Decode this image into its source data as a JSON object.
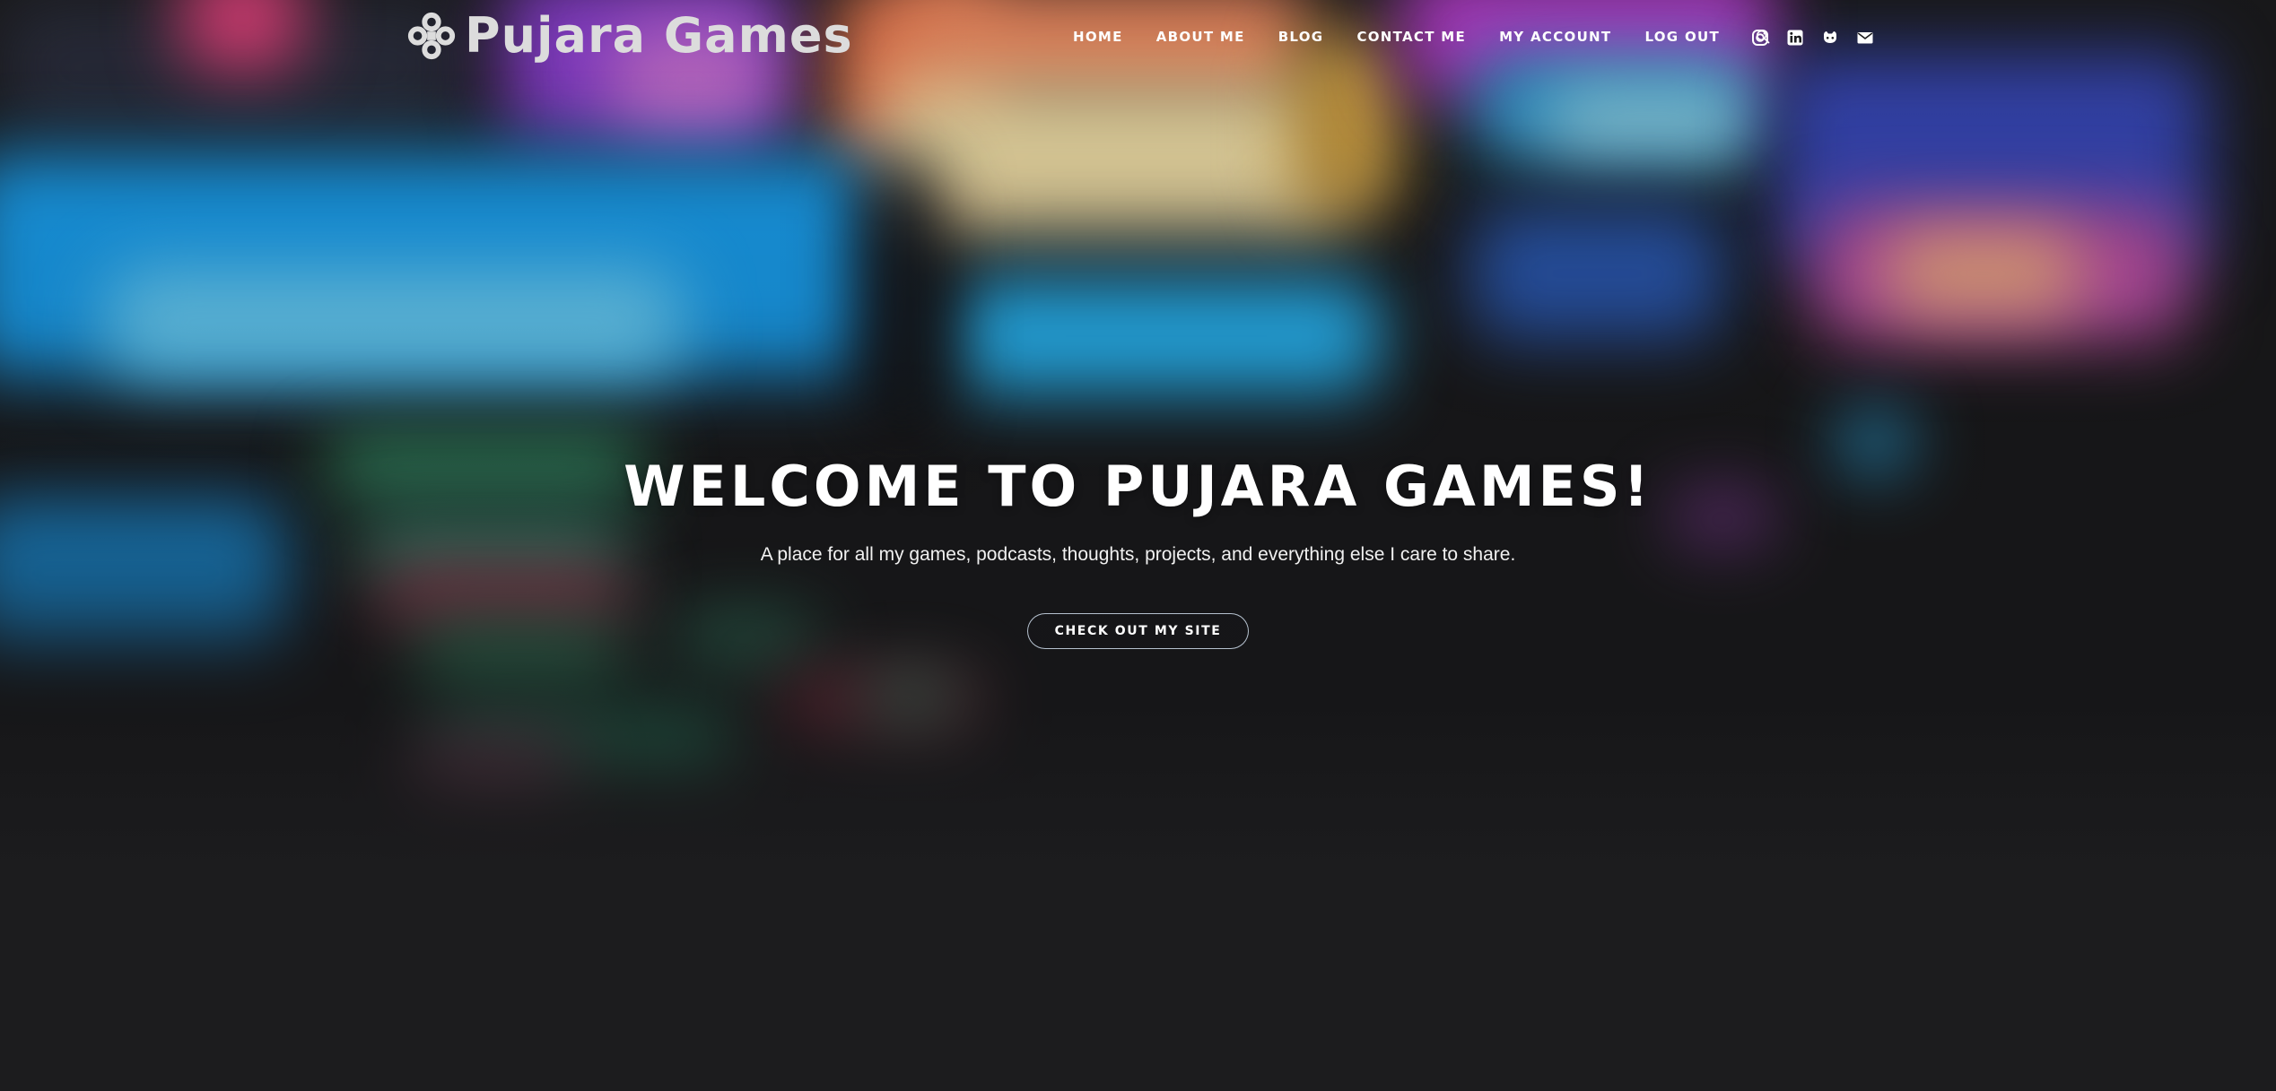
{
  "site": {
    "logo_text": "Pujara Games"
  },
  "nav": {
    "items": [
      {
        "label": "HOME",
        "name": "nav-home"
      },
      {
        "label": "ABOUT ME",
        "name": "nav-about-me"
      },
      {
        "label": "BLOG",
        "name": "nav-blog"
      },
      {
        "label": "CONTACT ME",
        "name": "nav-contact-me"
      },
      {
        "label": "MY ACCOUNT",
        "name": "nav-my-account"
      },
      {
        "label": "LOG OUT",
        "name": "nav-log-out"
      }
    ],
    "search_icon": "search-icon"
  },
  "social": {
    "icons": [
      "instagram-icon",
      "linkedin-icon",
      "github-icon",
      "envelope-icon"
    ]
  },
  "hero": {
    "title": "WELCOME TO PUJARA GAMES!",
    "subtitle": "A place for all my games, podcasts, thoughts, projects, and everything else I care to share.",
    "cta_label": "CHECK OUT MY SITE"
  },
  "colors": {
    "background": "#1c1c1e",
    "text": "#ffffff",
    "logo": "#dcdcdc",
    "button_border": "#d2e1f0"
  }
}
